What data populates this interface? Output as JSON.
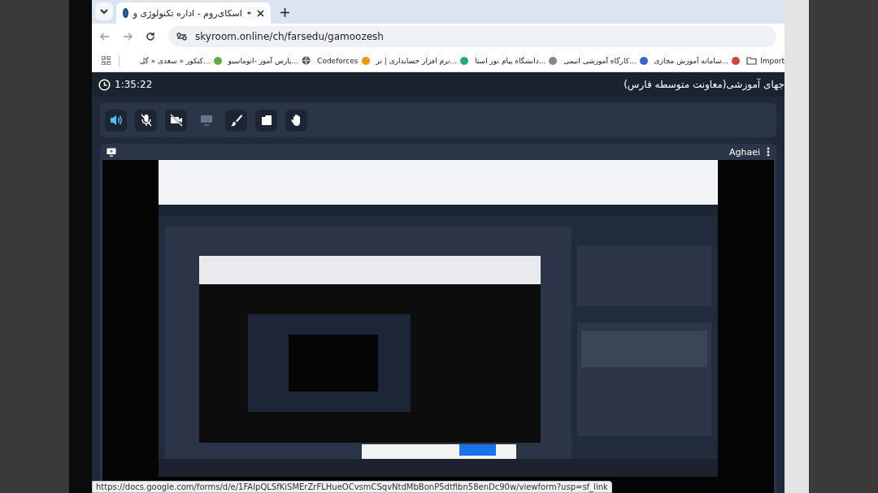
{
  "browser": {
    "tabs": [
      {
        "title": "اسکای‌روم - اداره تکنولوژی و",
        "audio": true,
        "selected": true
      }
    ],
    "address": "skyroom.online/ch/farsedu/gamoozesh",
    "bookmarks": [
      {
        "label": "Import",
        "kind": "folder"
      },
      {
        "label": "سامانه آموزش مجازی...",
        "kind": "site"
      },
      {
        "label": "کارگاه آموزشی انیمی...",
        "kind": "site"
      },
      {
        "label": "دانشگاه پیام نور استا...",
        "kind": "site"
      },
      {
        "label": "نرم افزار حسابداری | نر...",
        "kind": "site"
      },
      {
        "label": "Codeforces",
        "kind": "site"
      },
      {
        "label": "پارس آموز -اتوماسیو...",
        "kind": "globe"
      },
      {
        "label": "کنکور « سعدی « گل...",
        "kind": "site"
      }
    ],
    "status_url": "https://docs.google.com/forms/d/e/1FAIpQLSfKiSMErZrFLHueOCvsmCSqvNtdMbBonP5dtfibn58enDc90w/viewform?usp=sf_link"
  },
  "room": {
    "timer": "1:35:22",
    "title": "جهای آموزشی(معاونت متوسطه فارس)",
    "controls": [
      {
        "kind": "speaker",
        "on": true
      },
      {
        "kind": "mic",
        "on": false
      },
      {
        "kind": "camera",
        "on": false
      },
      {
        "kind": "screen",
        "disabled": true
      },
      {
        "kind": "brush",
        "on": false
      },
      {
        "kind": "folder",
        "on": false
      },
      {
        "kind": "hand",
        "on": false
      }
    ],
    "video": {
      "presenter": "Aghaei"
    }
  }
}
